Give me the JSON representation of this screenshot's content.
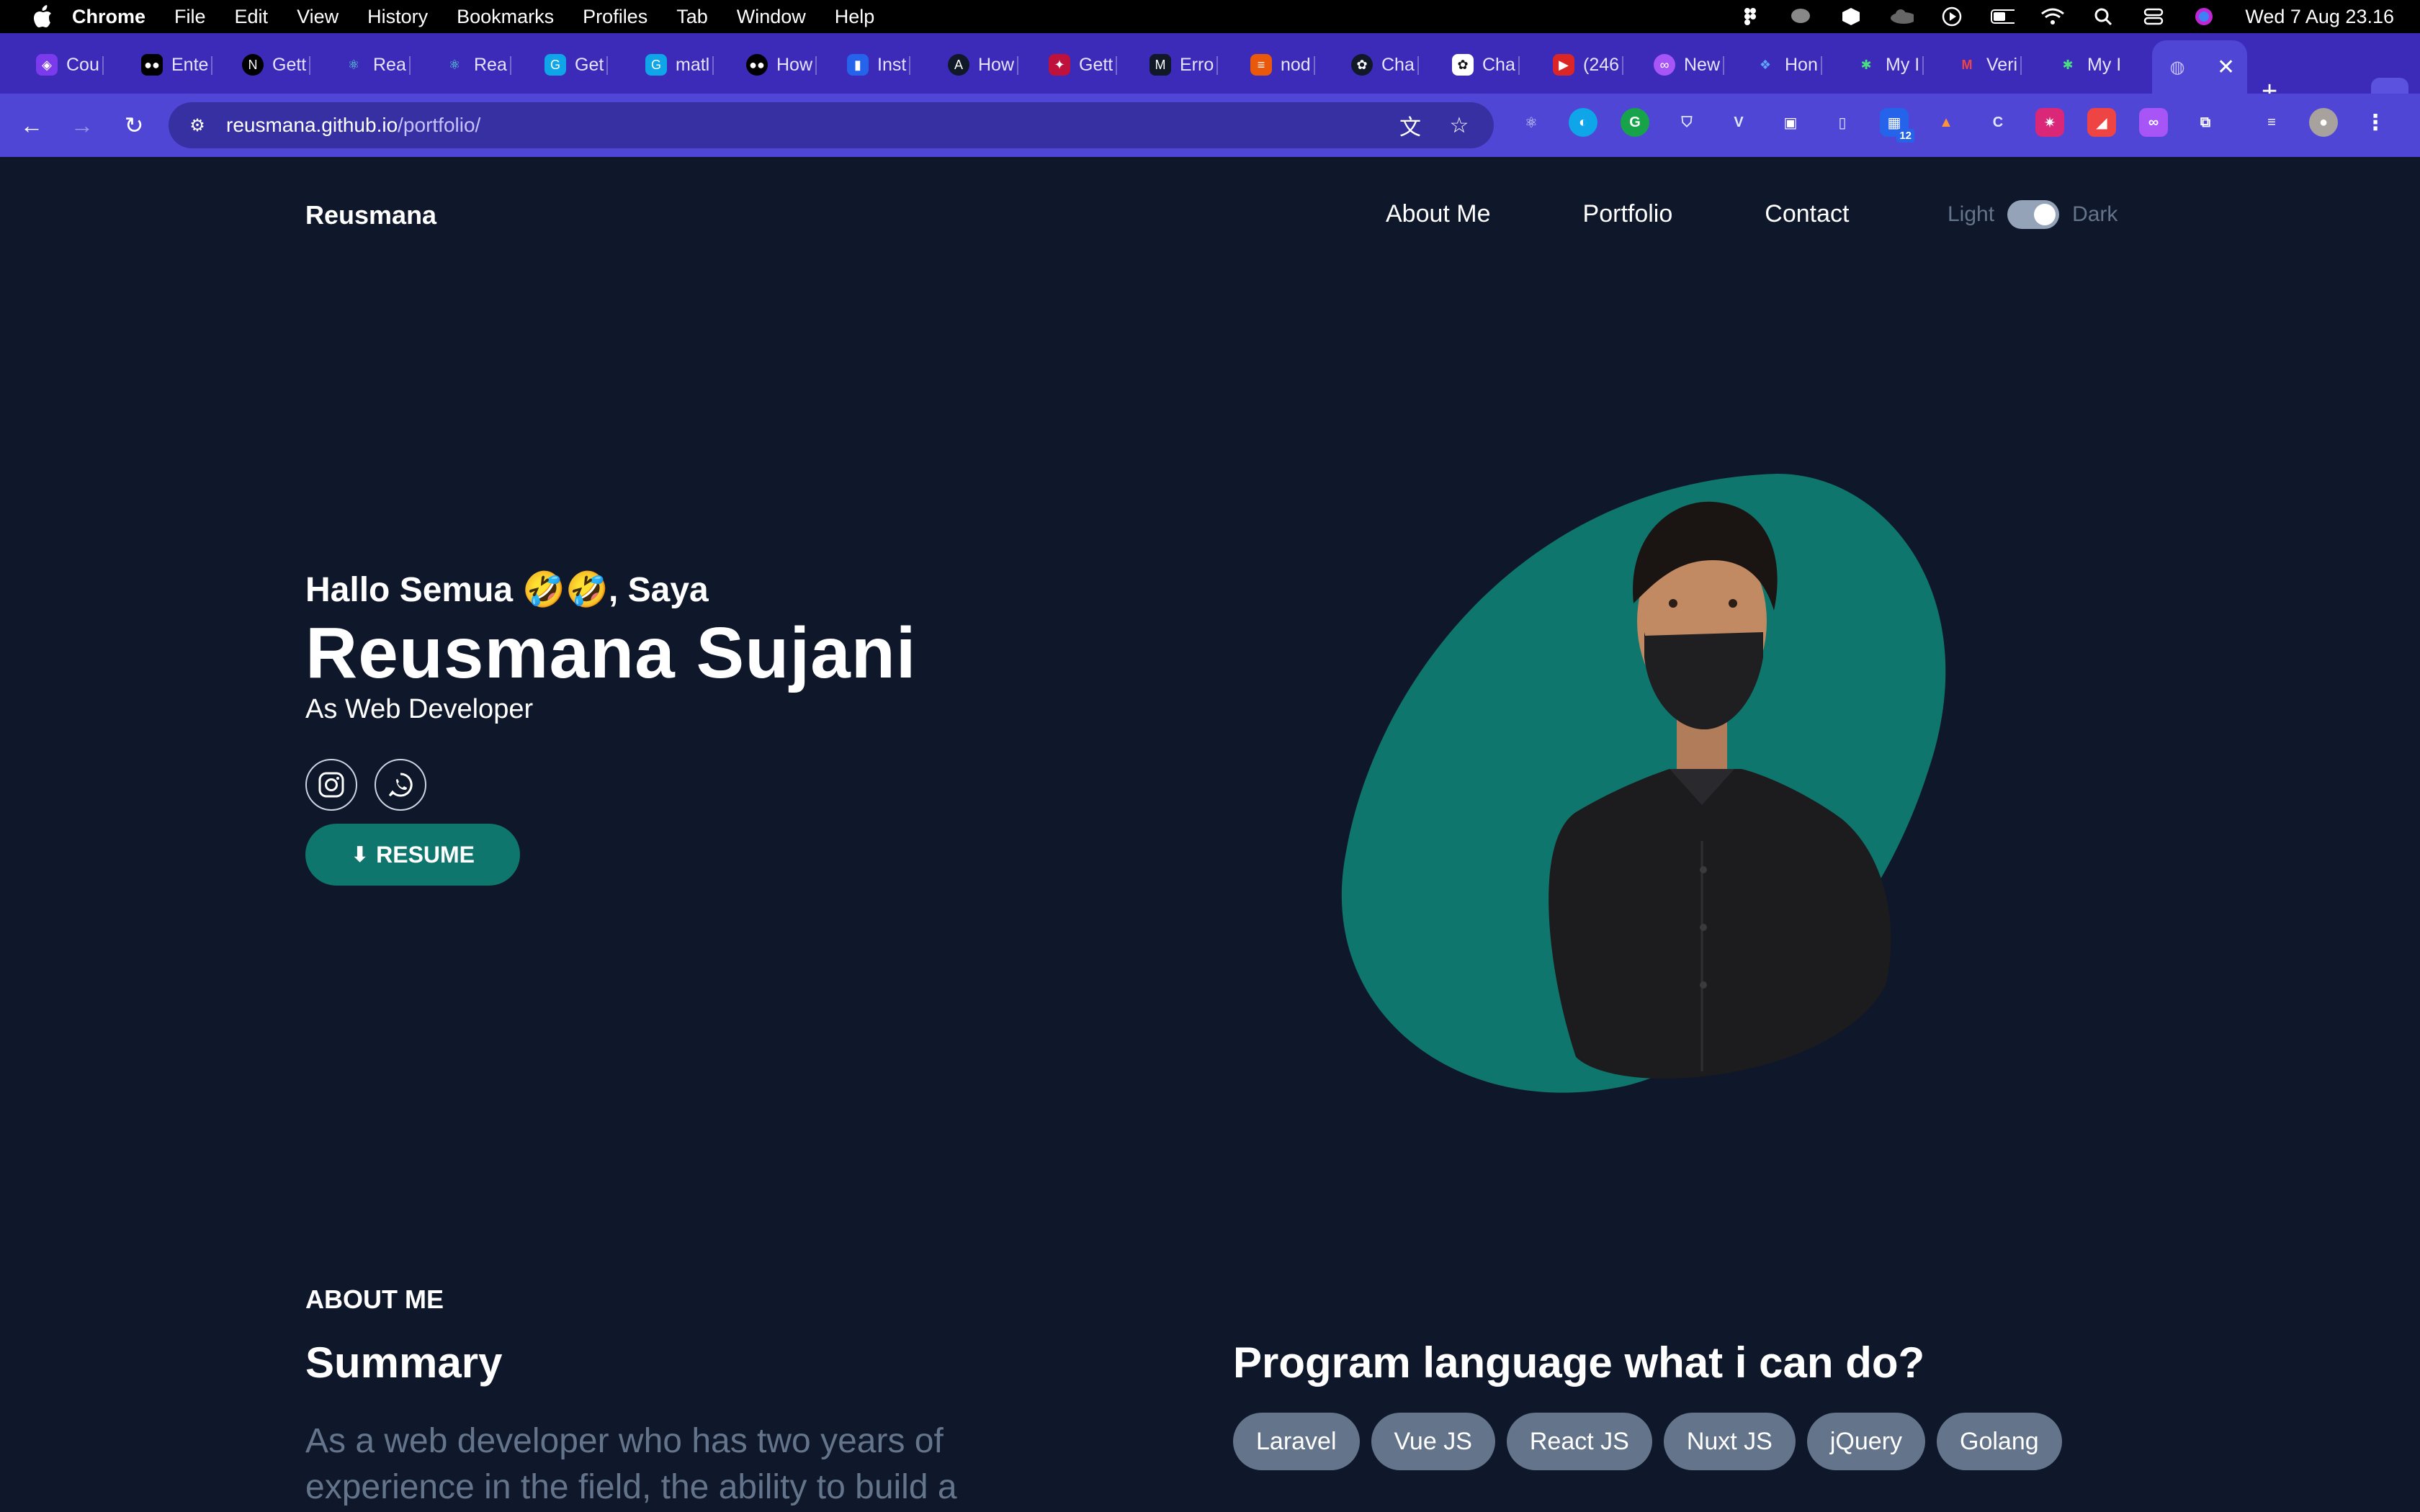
{
  "menubar": {
    "app_name": "Chrome",
    "menus": [
      "File",
      "Edit",
      "View",
      "History",
      "Bookmarks",
      "Profiles",
      "Tab",
      "Window",
      "Help"
    ],
    "clock": "Wed 7 Aug  23.16"
  },
  "tabs": [
    {
      "label": "Cou",
      "icon": "shield-icon",
      "color": "#7c3aed"
    },
    {
      "label": "Ente",
      "icon": "medium-icon",
      "color": "#000000"
    },
    {
      "label": "Gett",
      "icon": "nextjs-icon",
      "color": "#000000"
    },
    {
      "label": "Rea",
      "icon": "react-icon",
      "color": "#0f766e"
    },
    {
      "label": "Rea",
      "icon": "react-icon",
      "color": "#0f766e"
    },
    {
      "label": "Get",
      "icon": "golang-icon",
      "color": "#0ea5e9"
    },
    {
      "label": "matl",
      "icon": "golang-icon",
      "color": "#0ea5e9"
    },
    {
      "label": "How",
      "icon": "medium-icon",
      "color": "#000000"
    },
    {
      "label": "Inst",
      "icon": "app-icon",
      "color": "#2563eb"
    },
    {
      "label": "How",
      "icon": "angular-icon",
      "color": "#111827"
    },
    {
      "label": "Gett",
      "icon": "nestjs-icon",
      "color": "#be123c"
    },
    {
      "label": "Erro",
      "icon": "m-icon",
      "color": "#111827"
    },
    {
      "label": "nod",
      "icon": "stack-icon",
      "color": "#ea580c"
    },
    {
      "label": "Cha",
      "icon": "openai-icon",
      "color": "#111827"
    },
    {
      "label": "Cha",
      "icon": "openai-icon",
      "color": "#ffffff"
    },
    {
      "label": "(246",
      "icon": "youtube-icon",
      "color": "#dc2626"
    },
    {
      "label": "New",
      "icon": "extension-icon",
      "color": "#a855f7"
    },
    {
      "label": "Hon",
      "icon": "app-icon",
      "color": "#1d4ed8"
    },
    {
      "label": "My I",
      "icon": "app-icon",
      "color": "#15803d"
    },
    {
      "label": "Veri",
      "icon": "gmail-icon",
      "color": "#ef4444"
    },
    {
      "label": "My I",
      "icon": "app-icon",
      "color": "#15803d"
    }
  ],
  "toolbar": {
    "url_host": "reusmana.github.io",
    "url_path": "/portfolio/",
    "extension_badge": "12"
  },
  "site": {
    "brand": "Reusmana",
    "nav": [
      "About Me",
      "Portfolio",
      "Contact"
    ],
    "theme_light": "Light",
    "theme_dark": "Dark",
    "greeting": "Hallo Semua 🤣🤣, Saya",
    "name": "Reusmana Sujani",
    "role": "As Web Developer",
    "resume_label": "RESUME",
    "about_label": "ABOUT ME",
    "summary_title": "Summary",
    "summary_text": "As a web developer who has two years of experience in the field, the ability to build a",
    "skills_title": "Program language what i can do?",
    "skills": [
      "Laravel",
      "Vue JS",
      "React JS",
      "Nuxt JS",
      "jQuery",
      "Golang"
    ],
    "accent_color": "#0f766e",
    "background_color": "#0f172a"
  }
}
